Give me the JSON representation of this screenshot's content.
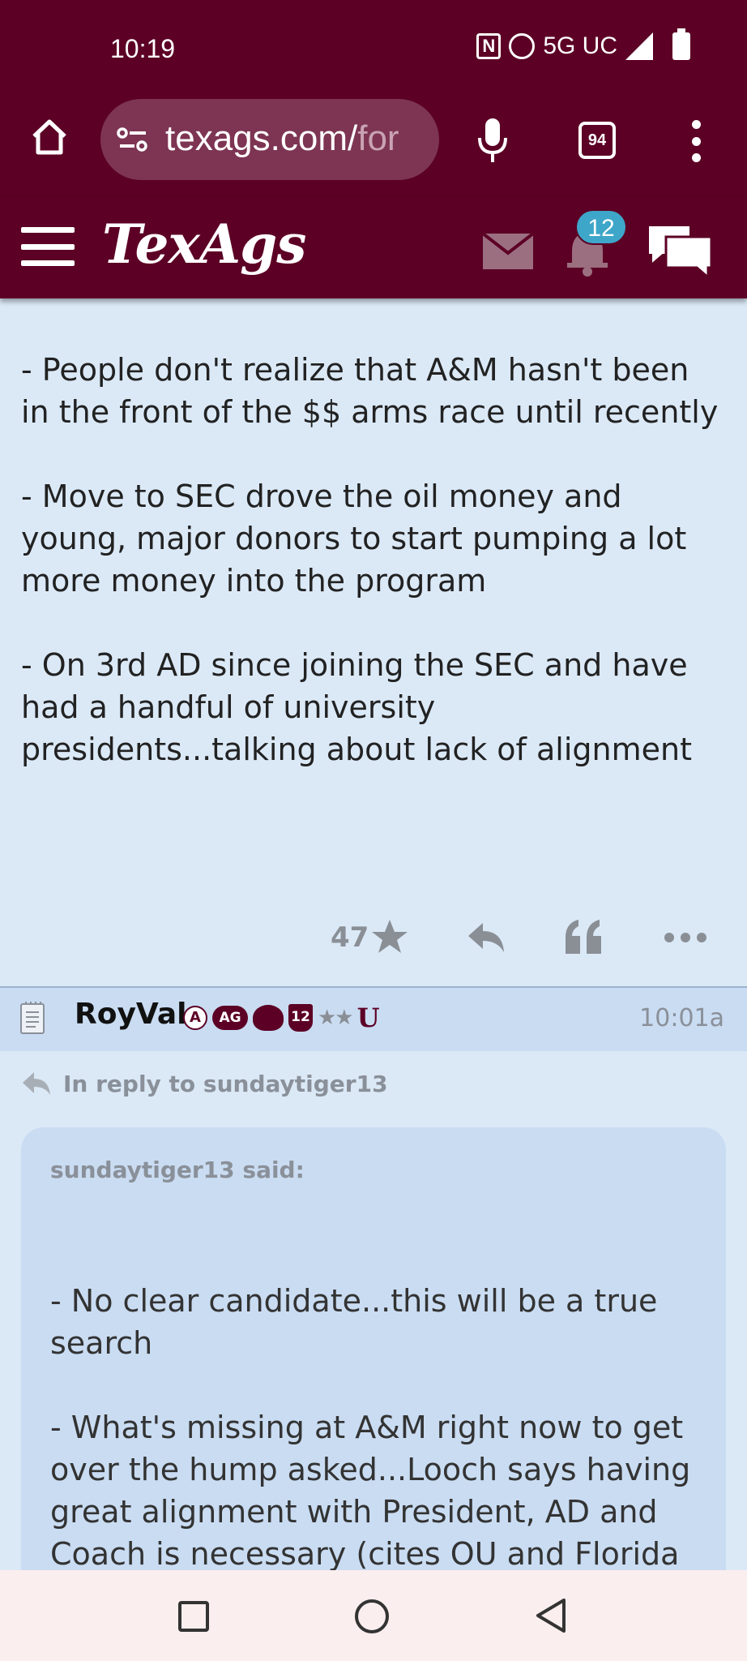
{
  "status_bar": {
    "time": "10:19",
    "network": "5G UC",
    "icons": [
      "nfc-icon",
      "alarm-icon",
      "signal-icon",
      "battery-icon"
    ]
  },
  "browser": {
    "url_main": "texags.com/",
    "url_rest": "for",
    "tab_count": "94",
    "icons": [
      "home-icon",
      "site-settings-icon",
      "mic-icon",
      "tabs-icon",
      "more-vert-icon"
    ]
  },
  "site_header": {
    "logo": "TexAgs",
    "notification_count": "12",
    "icons": [
      "hamburger-icon",
      "mail-icon",
      "bell-icon",
      "chat-icon"
    ]
  },
  "post1": {
    "paragraphs": [
      "- People don't realize that A&M hasn't been in the front of the $$ arms race until recently",
      "- Move to SEC drove the oil money and young, major donors to start pumping a lot more money into the program",
      "- On 3rd AD since joining the SEC and have had a handful of university presidents...talking about lack of alignment"
    ],
    "likes": "47"
  },
  "post2": {
    "username": "RoyVal",
    "badges": {
      "a": "A",
      "ag": "AG",
      "twelve": "12",
      "stars": "★★",
      "u": "U"
    },
    "time": "10:01a",
    "in_reply_to": "In reply to sundaytiger13",
    "quote": {
      "author": "sundaytiger13 said:",
      "paragraphs": [
        "- No clear candidate...this will be a true search",
        "- What's missing at A&M right now to get over the hump asked...Looch says having great alignment with President, AD and Coach is necessary (cites OU and Florida in"
      ]
    }
  },
  "colors": {
    "header_maroon": "#5c0025",
    "page_bg": "#dbe9f7",
    "post_header_bg": "#c9dcf2",
    "badge_blue": "#3ea6c9"
  }
}
